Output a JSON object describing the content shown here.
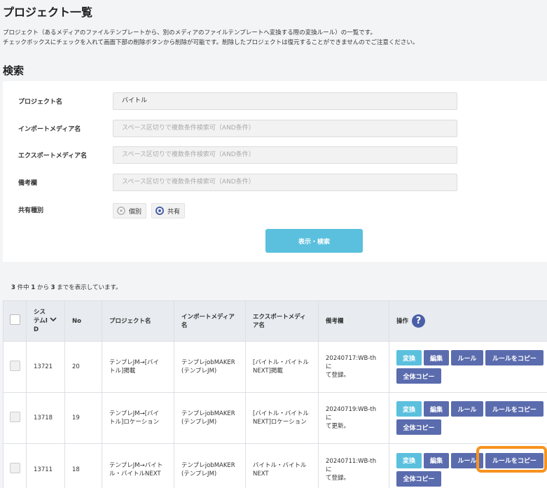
{
  "page": {
    "title": "プロジェクト一覧",
    "description_line1": "プロジェクト（あるメディアのファイルテンプレートから、別のメディアのファイルテンプレートへ変換する際の変換ルール）の一覧です。",
    "description_line2": "チェックボックスにチェックを入れて画面下部の削除ボタンから削除が可能です。削除したプロジェクトは復元することができませんのでご注意ください。"
  },
  "search": {
    "section_title": "検索",
    "project_name_label": "プロジェクト名",
    "project_name_value": "バイトル",
    "import_media_label": "インポートメディア名",
    "import_media_placeholder": "スペース区切りで複数条件検索可（AND条件）",
    "export_media_label": "エクスポートメディア名",
    "export_media_placeholder": "スペース区切りで複数条件検索可（AND条件）",
    "remarks_label": "備考欄",
    "remarks_placeholder": "スペース区切りで複数条件検索可（AND条件）",
    "share_type_label": "共有種別",
    "share_options": [
      "個別",
      "共有"
    ],
    "share_selected": "共有",
    "submit_label": "表示・検索"
  },
  "results": {
    "count_total": "3",
    "count_mid1": " 件中 ",
    "count_from": "1",
    "count_mid2": " から ",
    "count_to": "3",
    "count_suffix": " までを表示しています。",
    "columns": {
      "system_id_line1": "シス",
      "system_id_line2": "テムI",
      "system_id_line3": "D",
      "no": "No",
      "project_name": "プロジェクト名",
      "import_media_line1": "インポートメディア",
      "import_media_line2": "名",
      "export_media_line1": "エクスポートメディ",
      "export_media_line2": "ア名",
      "remarks": "備考欄",
      "actions": "操作"
    },
    "buttons": {
      "convert": "変換",
      "edit": "編集",
      "rule": "ルール",
      "copy_rule": "ルールをコピー",
      "copy_all": "全体コピー"
    },
    "rows": [
      {
        "system_id": "13721",
        "no": "20",
        "project_line1": "テンプレJM→[バイ",
        "project_line2": "トル]掲載",
        "import_line1": "テンプレjobMAKER",
        "import_line2": "(テンプレJM)",
        "export_line1": "[バイトル・バイトル",
        "export_line2": "NEXT]掲載",
        "remarks_line1": "20240717:WB-thに",
        "remarks_line2": "て登録。"
      },
      {
        "system_id": "13718",
        "no": "19",
        "project_line1": "テンプレJM→[バイ",
        "project_line2": "トル]ロケーション",
        "import_line1": "テンプレjobMAKER",
        "import_line2": "(テンプレJM)",
        "export_line1": "[バイトル・バイトル",
        "export_line2": "NEXT]ロケーション",
        "remarks_line1": "20240719:WB-thに",
        "remarks_line2": "て更新。"
      },
      {
        "system_id": "13711",
        "no": "18",
        "project_line1": "テンプレJM→バイト",
        "project_line2": "ル・バイトルNEXT",
        "import_line1": "テンプレjobMAKER",
        "import_line2": "(テンプレJM)",
        "export_line1": "バイトル・バイトル",
        "export_line2": "NEXT",
        "remarks_line1": "20240711:WB-thに",
        "remarks_line2": "て登録。"
      }
    ]
  },
  "colors": {
    "teal": "#5bc0de",
    "navy": "#5b6cae",
    "highlight": "#f7931e"
  },
  "icons": [
    "sort-down-icon",
    "help-icon"
  ]
}
